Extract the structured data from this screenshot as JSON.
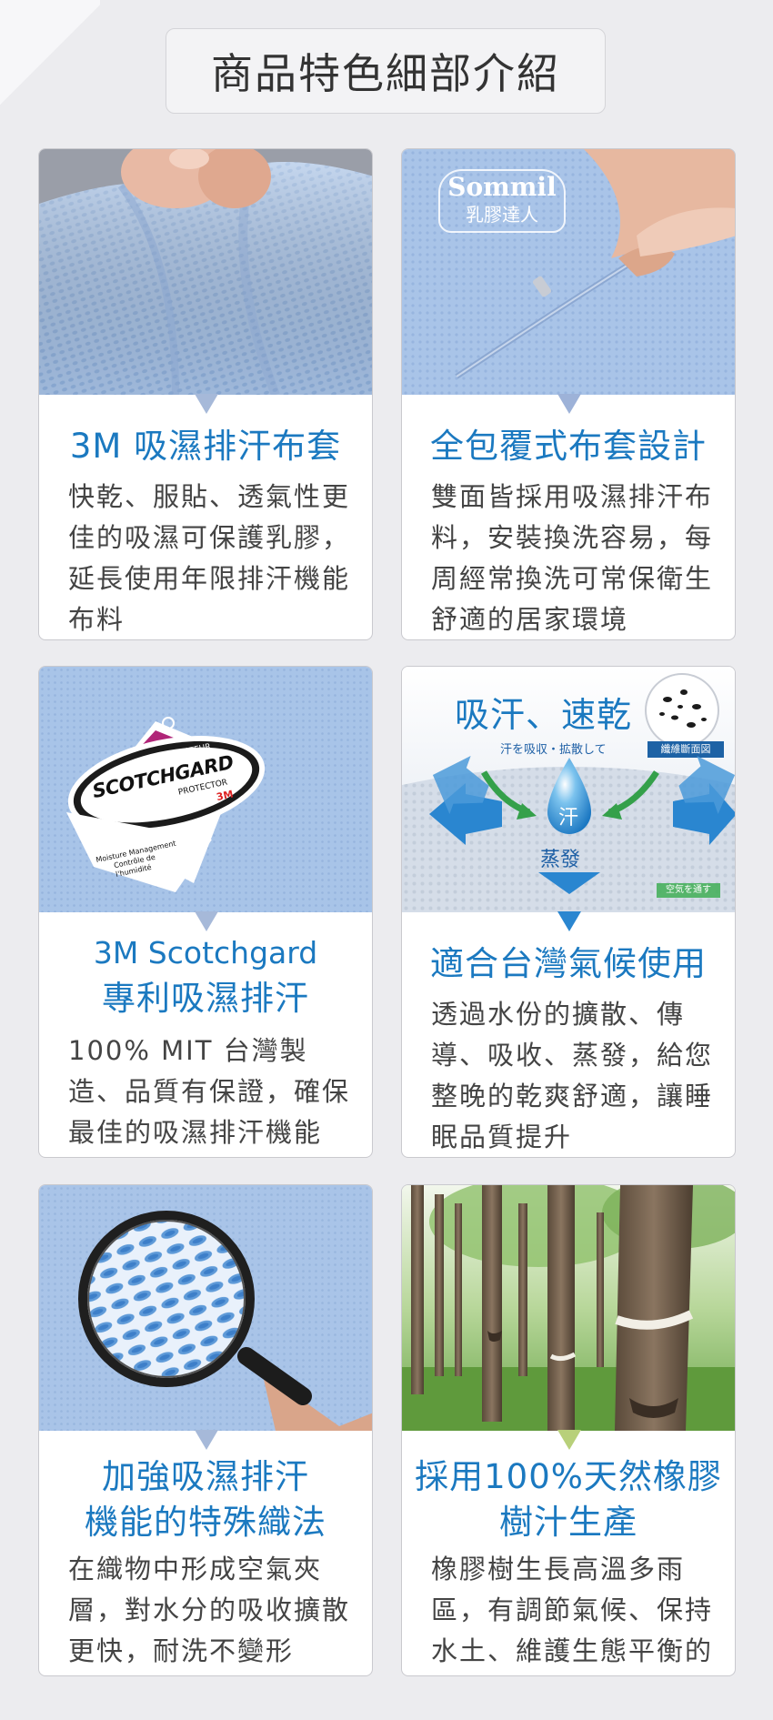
{
  "page": {
    "title": "商品特色細部介紹"
  },
  "cards": [
    {
      "heading": "3M 吸濕排汗布套",
      "body": "快乾、服貼、透氣性更佳的吸濕可保護乳膠，延長使用年限排汗機能布料",
      "photo": "hand-pinching-blue-mesh-fabric"
    },
    {
      "heading": "全包覆式布套設計",
      "body": "雙面皆採用吸濕排汗布料，安裝換洗容易，每周經常換洗可常保衛生舒適的居家環境",
      "photo": "hand-opening-zipper-on-blue-cover",
      "brand_en": "Sommil",
      "brand_zh": "乳膠達人"
    },
    {
      "heading_en": "3M Scotchgard",
      "heading": "專利吸濕排汗",
      "body": "100% MIT 台灣製造、品質有保證，確保最佳的吸濕排汗機能",
      "photo": "scotchgard-hang-tag-on-blue-fabric",
      "tag": {
        "top_label": "PROTECTEUR",
        "brand": "SCOTCHGARD",
        "sub_label": "PROTECTOR",
        "logo": "3M",
        "line1": "Moisture Management",
        "line2": "Contrôle de",
        "line3": "l'humidité"
      }
    },
    {
      "heading": "適合台灣氣候使用",
      "body": "透過水份的擴散、傳導、吸收、蒸發，給您整晚的乾爽舒適，讓睡眠品質提升",
      "photo": "sweat-diffusion-diagram",
      "diagram": {
        "title": "吸汗、速乾",
        "subtitle": "汗を吸収・拡散して",
        "badge": "纖維斷面図",
        "drop_label": "汗",
        "bottom_label": "蒸發",
        "corner_label": "空気を通す"
      }
    },
    {
      "heading": "加強吸濕排汗機能的特殊織法",
      "heading_line1": "加強吸濕排汗",
      "heading_line2": "機能的特殊織法",
      "body": "在織物中形成空氣夾層，對水分的吸收擴散更快，耐洗不變形",
      "photo": "magnifier-over-woven-fabric"
    },
    {
      "heading": "採用100%天然橡膠樹汁生產",
      "heading_line1": "採用100%天然橡膠",
      "heading_line2": "樹汁生產",
      "body": "橡膠樹生長高溫多雨區，有調節氣候、保持水土、維護生態平衡的功能",
      "photo": "rubber-tree-plantation"
    }
  ],
  "colors": {
    "background": "#ececef",
    "heading": "#1b79c0",
    "body_text": "#444444",
    "card_border": "#c9c9ce",
    "fabric_blue": "#a9c3e6"
  }
}
